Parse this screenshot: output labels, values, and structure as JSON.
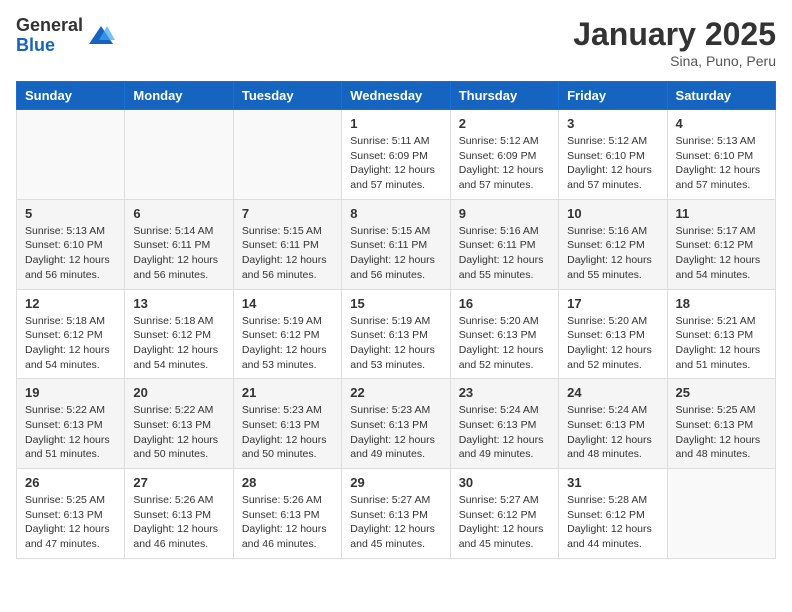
{
  "logo": {
    "general": "General",
    "blue": "Blue"
  },
  "title": "January 2025",
  "subtitle": "Sina, Puno, Peru",
  "days_of_week": [
    "Sunday",
    "Monday",
    "Tuesday",
    "Wednesday",
    "Thursday",
    "Friday",
    "Saturday"
  ],
  "weeks": [
    [
      {
        "day": "",
        "info": ""
      },
      {
        "day": "",
        "info": ""
      },
      {
        "day": "",
        "info": ""
      },
      {
        "day": "1",
        "info": "Sunrise: 5:11 AM\nSunset: 6:09 PM\nDaylight: 12 hours\nand 57 minutes."
      },
      {
        "day": "2",
        "info": "Sunrise: 5:12 AM\nSunset: 6:09 PM\nDaylight: 12 hours\nand 57 minutes."
      },
      {
        "day": "3",
        "info": "Sunrise: 5:12 AM\nSunset: 6:10 PM\nDaylight: 12 hours\nand 57 minutes."
      },
      {
        "day": "4",
        "info": "Sunrise: 5:13 AM\nSunset: 6:10 PM\nDaylight: 12 hours\nand 57 minutes."
      }
    ],
    [
      {
        "day": "5",
        "info": "Sunrise: 5:13 AM\nSunset: 6:10 PM\nDaylight: 12 hours\nand 56 minutes."
      },
      {
        "day": "6",
        "info": "Sunrise: 5:14 AM\nSunset: 6:11 PM\nDaylight: 12 hours\nand 56 minutes."
      },
      {
        "day": "7",
        "info": "Sunrise: 5:15 AM\nSunset: 6:11 PM\nDaylight: 12 hours\nand 56 minutes."
      },
      {
        "day": "8",
        "info": "Sunrise: 5:15 AM\nSunset: 6:11 PM\nDaylight: 12 hours\nand 56 minutes."
      },
      {
        "day": "9",
        "info": "Sunrise: 5:16 AM\nSunset: 6:11 PM\nDaylight: 12 hours\nand 55 minutes."
      },
      {
        "day": "10",
        "info": "Sunrise: 5:16 AM\nSunset: 6:12 PM\nDaylight: 12 hours\nand 55 minutes."
      },
      {
        "day": "11",
        "info": "Sunrise: 5:17 AM\nSunset: 6:12 PM\nDaylight: 12 hours\nand 54 minutes."
      }
    ],
    [
      {
        "day": "12",
        "info": "Sunrise: 5:18 AM\nSunset: 6:12 PM\nDaylight: 12 hours\nand 54 minutes."
      },
      {
        "day": "13",
        "info": "Sunrise: 5:18 AM\nSunset: 6:12 PM\nDaylight: 12 hours\nand 54 minutes."
      },
      {
        "day": "14",
        "info": "Sunrise: 5:19 AM\nSunset: 6:12 PM\nDaylight: 12 hours\nand 53 minutes."
      },
      {
        "day": "15",
        "info": "Sunrise: 5:19 AM\nSunset: 6:13 PM\nDaylight: 12 hours\nand 53 minutes."
      },
      {
        "day": "16",
        "info": "Sunrise: 5:20 AM\nSunset: 6:13 PM\nDaylight: 12 hours\nand 52 minutes."
      },
      {
        "day": "17",
        "info": "Sunrise: 5:20 AM\nSunset: 6:13 PM\nDaylight: 12 hours\nand 52 minutes."
      },
      {
        "day": "18",
        "info": "Sunrise: 5:21 AM\nSunset: 6:13 PM\nDaylight: 12 hours\nand 51 minutes."
      }
    ],
    [
      {
        "day": "19",
        "info": "Sunrise: 5:22 AM\nSunset: 6:13 PM\nDaylight: 12 hours\nand 51 minutes."
      },
      {
        "day": "20",
        "info": "Sunrise: 5:22 AM\nSunset: 6:13 PM\nDaylight: 12 hours\nand 50 minutes."
      },
      {
        "day": "21",
        "info": "Sunrise: 5:23 AM\nSunset: 6:13 PM\nDaylight: 12 hours\nand 50 minutes."
      },
      {
        "day": "22",
        "info": "Sunrise: 5:23 AM\nSunset: 6:13 PM\nDaylight: 12 hours\nand 49 minutes."
      },
      {
        "day": "23",
        "info": "Sunrise: 5:24 AM\nSunset: 6:13 PM\nDaylight: 12 hours\nand 49 minutes."
      },
      {
        "day": "24",
        "info": "Sunrise: 5:24 AM\nSunset: 6:13 PM\nDaylight: 12 hours\nand 48 minutes."
      },
      {
        "day": "25",
        "info": "Sunrise: 5:25 AM\nSunset: 6:13 PM\nDaylight: 12 hours\nand 48 minutes."
      }
    ],
    [
      {
        "day": "26",
        "info": "Sunrise: 5:25 AM\nSunset: 6:13 PM\nDaylight: 12 hours\nand 47 minutes."
      },
      {
        "day": "27",
        "info": "Sunrise: 5:26 AM\nSunset: 6:13 PM\nDaylight: 12 hours\nand 46 minutes."
      },
      {
        "day": "28",
        "info": "Sunrise: 5:26 AM\nSunset: 6:13 PM\nDaylight: 12 hours\nand 46 minutes."
      },
      {
        "day": "29",
        "info": "Sunrise: 5:27 AM\nSunset: 6:13 PM\nDaylight: 12 hours\nand 45 minutes."
      },
      {
        "day": "30",
        "info": "Sunrise: 5:27 AM\nSunset: 6:12 PM\nDaylight: 12 hours\nand 45 minutes."
      },
      {
        "day": "31",
        "info": "Sunrise: 5:28 AM\nSunset: 6:12 PM\nDaylight: 12 hours\nand 44 minutes."
      },
      {
        "day": "",
        "info": ""
      }
    ]
  ]
}
